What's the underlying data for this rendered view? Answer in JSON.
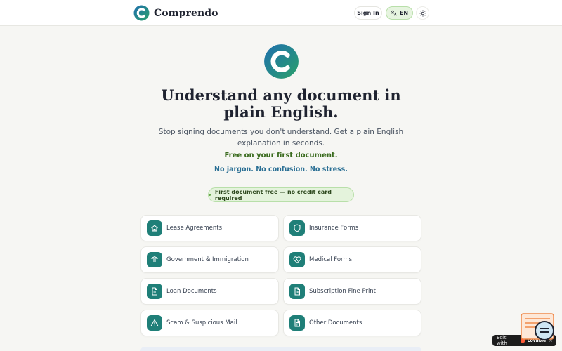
{
  "header": {
    "brand": "Comprendo",
    "sign_in": "Sign In",
    "language": "EN"
  },
  "hero": {
    "title": "Understand any document in plain English.",
    "subtitle": "Stop signing documents you don't understand. Get a plain English explanation in seconds.",
    "free_line": "Free on your first document.",
    "tagline": "No jargon. No confusion. No stress.",
    "pill": "First document free — no credit card required"
  },
  "categories": [
    {
      "label": "Lease Agreements",
      "icon": "house-icon"
    },
    {
      "label": "Insurance Forms",
      "icon": "shield-icon"
    },
    {
      "label": "Government & Immigration",
      "icon": "landmark-icon"
    },
    {
      "label": "Medical Forms",
      "icon": "heart-pulse-icon"
    },
    {
      "label": "Loan Documents",
      "icon": "document-icon"
    },
    {
      "label": "Subscription Fine Print",
      "icon": "document-search-icon"
    },
    {
      "label": "Scam & Suspicious Mail",
      "icon": "warning-icon"
    },
    {
      "label": "Other Documents",
      "icon": "document-lines-icon"
    }
  ],
  "edit_badge": {
    "text": "Edit with",
    "brand": "Lovable",
    "close": "×"
  },
  "colors": {
    "accent_teal": "#1f7f78",
    "accent_green": "#3a6b1e",
    "accent_blue": "#2a6f94",
    "pill_bg": "#e4f3dc"
  }
}
